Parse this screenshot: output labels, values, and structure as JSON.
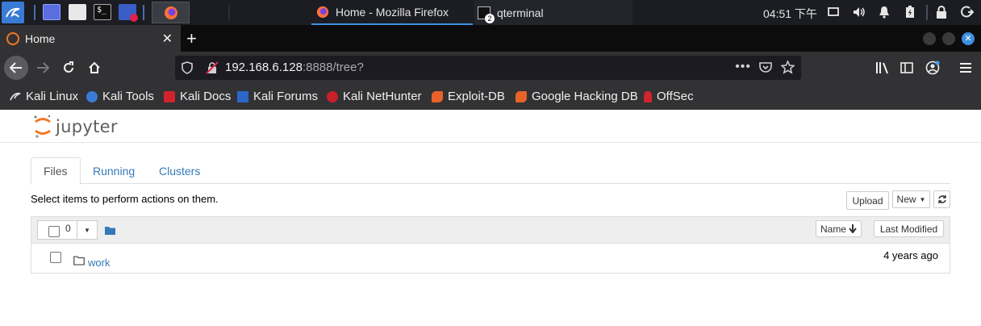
{
  "taskbar": {
    "tasks": [
      {
        "label": "Home - Mozilla Firefox",
        "active": true
      },
      {
        "label": "qterminal",
        "badge": "2",
        "active": false
      }
    ],
    "clock": "04:51 下午"
  },
  "browser": {
    "tab_title": "Home",
    "url_host": "192.168.6.128",
    "url_rest": ":8888/tree?"
  },
  "bookmarks": [
    {
      "label": "Kali Linux",
      "icon": "kali-linux-icon"
    },
    {
      "label": "Kali Tools",
      "icon": "kali-tools-icon"
    },
    {
      "label": "Kali Docs",
      "icon": "kali-docs-icon"
    },
    {
      "label": "Kali Forums",
      "icon": "kali-forums-icon"
    },
    {
      "label": "Kali NetHunter",
      "icon": "nethunter-icon"
    },
    {
      "label": "Exploit-DB",
      "icon": "exploit-db-icon"
    },
    {
      "label": "Google Hacking DB",
      "icon": "ghdb-icon"
    },
    {
      "label": "OffSec",
      "icon": "offsec-icon"
    }
  ],
  "jupyter": {
    "brand": "jupyter",
    "tabs": [
      {
        "label": "Files",
        "active": true
      },
      {
        "label": "Running",
        "active": false
      },
      {
        "label": "Clusters",
        "active": false
      }
    ],
    "hint": "Select items to perform actions on them.",
    "upload_label": "Upload",
    "new_label": "New",
    "selected_count": "0",
    "sort_name_label": "Name",
    "last_modified_label": "Last Modified",
    "items": [
      {
        "name": "work",
        "modified": "4 years ago",
        "type": "folder"
      }
    ]
  },
  "colors": {
    "link": "#337ab7",
    "jupyter_orange": "#f37726",
    "firefox_tab_bg": "#323234",
    "taskbar_bg": "#1b1d22"
  }
}
